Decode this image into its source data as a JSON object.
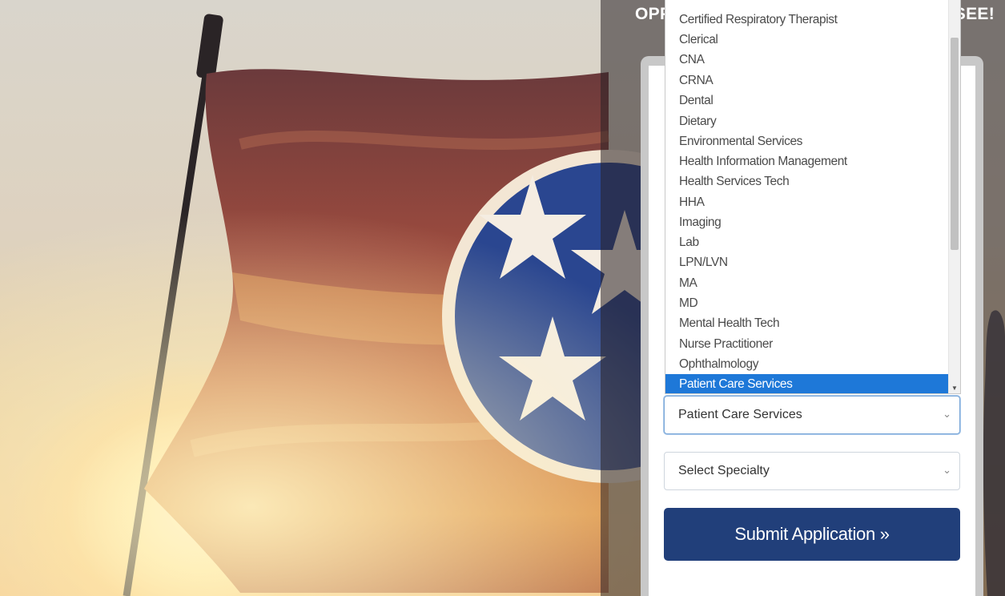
{
  "header": {
    "heading_left": "OPP",
    "heading_right": "SEE!"
  },
  "dropdown": {
    "options": [
      "Certified Respiratory Therapist",
      "Clerical",
      "CNA",
      "CRNA",
      "Dental",
      "Dietary",
      "Environmental Services",
      "Health Information Management",
      "Health Services Tech",
      "HHA",
      "Imaging",
      "Lab",
      "LPN/LVN",
      "MA",
      "MD",
      "Mental Health Tech",
      "Nurse Practitioner",
      "Ophthalmology",
      "Patient Care Services"
    ],
    "highlighted": "Patient Care Services"
  },
  "form": {
    "profession_value": "Patient Care Services",
    "specialty_value": "Select Specialty",
    "submit_label": "Submit Application »"
  },
  "colors": {
    "submit_bg": "#213f7a",
    "highlight": "#1e78d8",
    "seal_blue": "#2a4690"
  },
  "icons": {
    "select_arrow": "chevron-down-icon",
    "scroll_arrow": "scroll-down-arrow-icon"
  }
}
